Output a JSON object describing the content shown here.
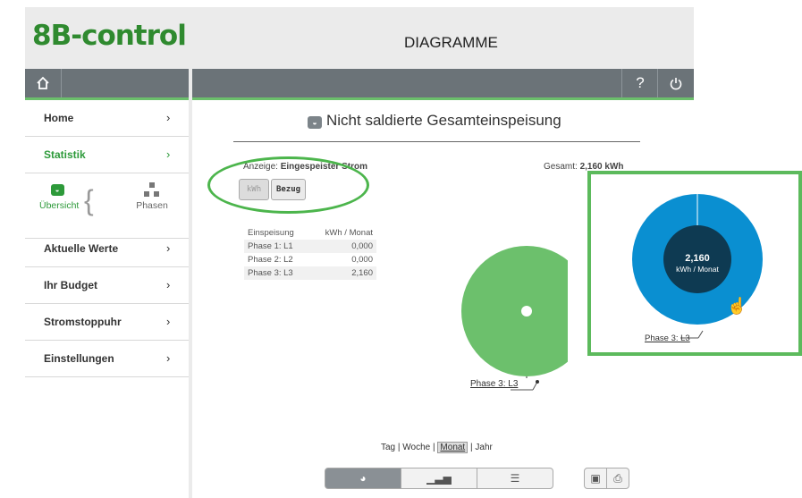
{
  "app": {
    "logo": "8B-control",
    "page_title": "DIAGRAMME"
  },
  "header": {
    "home_icon": "home-icon",
    "help_label": "?",
    "power_icon": "power-icon"
  },
  "sidebar": {
    "items": [
      {
        "label": "Home",
        "chevron": "›"
      },
      {
        "label": "Statistik",
        "chevron": "›"
      },
      {
        "label": "Aktuelle Werte",
        "chevron": "›"
      },
      {
        "label": "Ihr Budget",
        "chevron": "›"
      },
      {
        "label": "Stromstoppuhr",
        "chevron": "›"
      },
      {
        "label": "Einstellungen",
        "chevron": "›"
      }
    ],
    "sub": {
      "overview_label": "Übersicht",
      "phases_label": "Phasen"
    }
  },
  "main": {
    "title": "Nicht saldierte Gesamteinspeisung",
    "display_prefix": "Anzeige:",
    "display_value": "Eingespeister Strom",
    "total_prefix": "Gesamt:",
    "total_value": "2,160 kWh",
    "unit_buttons": [
      "kWh",
      "Bezug"
    ],
    "table": {
      "headers": [
        "Einspeisung",
        "kWh / Monat"
      ],
      "rows": [
        [
          "Phase 1: L1",
          "0,000"
        ],
        [
          "Phase 2: L2",
          "0,000"
        ],
        [
          "Phase 3: L3",
          "2,160"
        ]
      ]
    },
    "pie_label": "Phase 3: L3",
    "periods": [
      "Tag",
      "Woche",
      "Monat",
      "Jahr"
    ],
    "period_separator": "|",
    "selected_period": "Monat"
  },
  "zoom": {
    "value": "2,160",
    "unit": "kWh / Monat",
    "label": "Phase 3: L3"
  },
  "colors": {
    "brand_green": "#2f8a2f",
    "pie_green": "#6cc06c",
    "donut_blue": "#0a8fd1",
    "donut_center": "#0e3a52",
    "highlight_green": "#5cba5c",
    "header_gray": "#6b7378"
  }
}
